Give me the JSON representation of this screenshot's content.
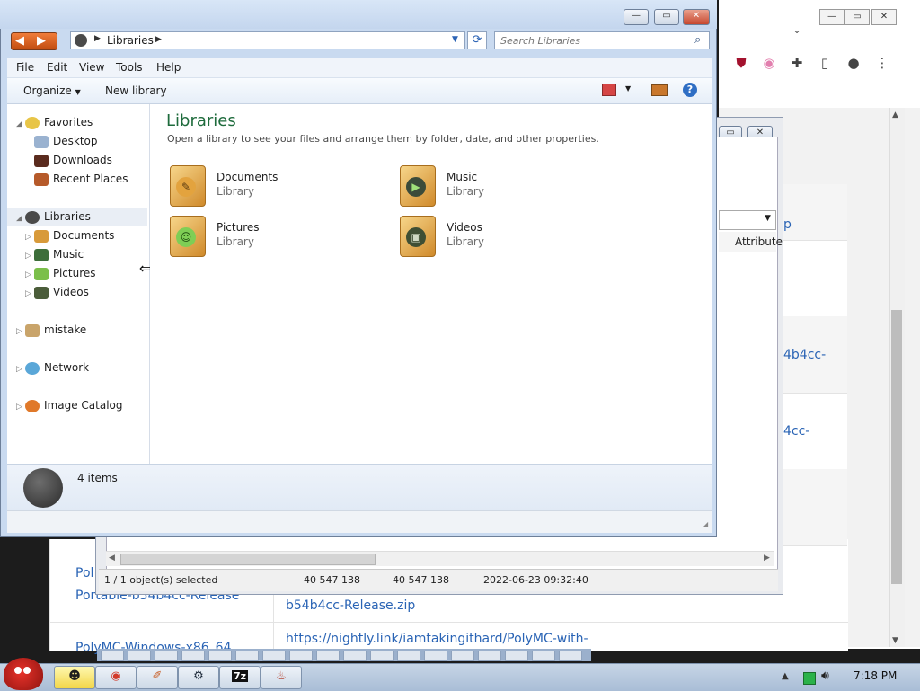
{
  "explorer": {
    "breadcrumb": "Libraries",
    "search_placeholder": "Search Libraries",
    "menu": [
      "File",
      "Edit",
      "View",
      "Tools",
      "Help"
    ],
    "toolbar": {
      "organize": "Organize",
      "new_library": "New library"
    },
    "nav": {
      "favorites": "Favorites",
      "favorites_items": [
        "Desktop",
        "Downloads",
        "Recent Places"
      ],
      "libraries": "Libraries",
      "libraries_items": [
        "Documents",
        "Music",
        "Pictures",
        "Videos"
      ],
      "mistake": "mistake",
      "network": "Network",
      "image_catalog": "Image Catalog"
    },
    "content": {
      "title": "Libraries",
      "subtitle": "Open a library to see your files and arrange them by folder, date, and other properties.",
      "items": [
        {
          "name": "Documents",
          "type": "Library"
        },
        {
          "name": "Music",
          "type": "Library"
        },
        {
          "name": "Pictures",
          "type": "Library"
        },
        {
          "name": "Videos",
          "type": "Library"
        }
      ]
    },
    "details": {
      "count": "4 items"
    }
  },
  "win2": {
    "header_col": "Attribute",
    "status": {
      "selected": "1 / 1 object(s) selected",
      "size1": "40 547 138",
      "size2": "40 547 138",
      "date": "2022-06-23 09:32:40"
    }
  },
  "browser": {
    "frag_zip_top": "p",
    "frag_b54_1": "4b4cc-",
    "frag_b54_2": "4cc-",
    "frag_poly": "Pol",
    "frag_portable": "Portable-b54b4cc-Release",
    "frag_release_zip": "b54b4cc-Release.zip",
    "frag_url": "https://nightly.link/iamtakingithard/PolyMC-with-",
    "frag_windows": "PolyMC-Windows-x86_64"
  },
  "taskbar": {
    "time": "7:18 PM",
    "seven_zip_label": "7z"
  },
  "colors": {
    "accent_title": "#1e6b3c",
    "link": "#2a64b5"
  }
}
